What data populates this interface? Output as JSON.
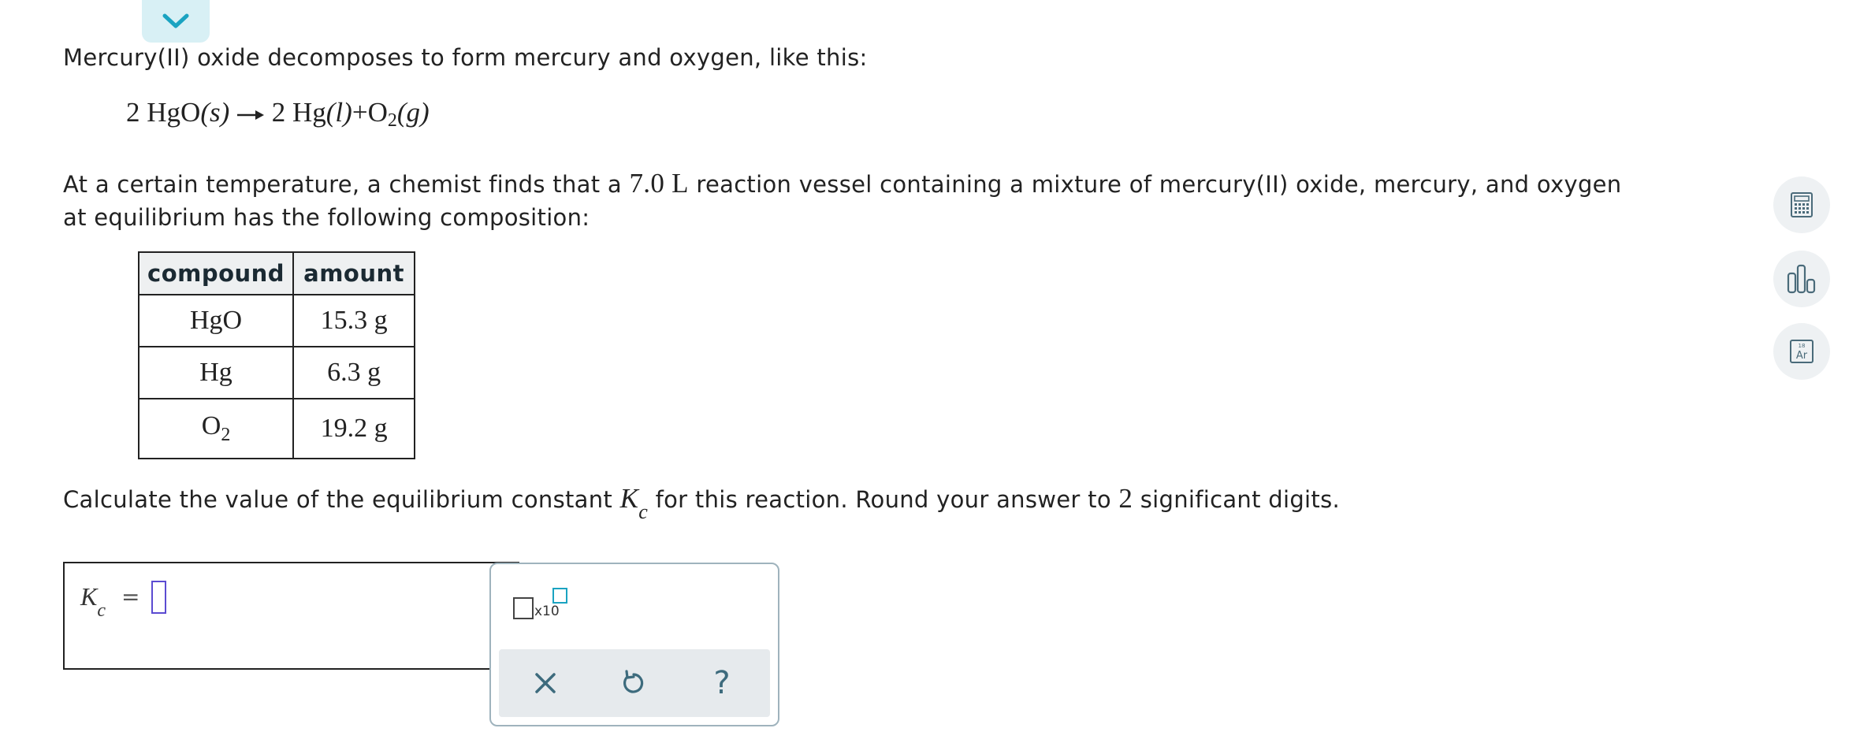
{
  "intro_text": "Mercury(II) oxide decomposes to form mercury and oxygen, like this:",
  "equation": {
    "coef1": "2",
    "reactant": "HgO",
    "reactant_phase": "(s)",
    "coef2": "2",
    "product1": "Hg",
    "product1_phase": "(l)",
    "product2": "O",
    "product2_sub": "2",
    "product2_phase": "(g)"
  },
  "context": {
    "before": "At a certain temperature, a chemist finds that a ",
    "volume": "7.0 L",
    "after": " reaction vessel containing a mixture of mercury(II) oxide, mercury, and oxygen at equilibrium has the following composition:"
  },
  "table": {
    "headers": [
      "compound",
      "amount"
    ],
    "rows": [
      {
        "compound": "HgO",
        "amount": "15.3 g"
      },
      {
        "compound": "Hg",
        "amount": "6.3 g"
      },
      {
        "compound": "O",
        "compound_sub": "2",
        "amount": "19.2 g"
      }
    ]
  },
  "question": {
    "before": "Calculate the value of the equilibrium constant ",
    "symbol": "K",
    "symbol_sub": "c",
    "middle": " for this reaction. Round your answer to ",
    "digits": "2",
    "after": " significant digits."
  },
  "answer": {
    "label": "K",
    "label_sub": "c",
    "equals": "=",
    "value": ""
  },
  "tools": {
    "x10_label": "x10",
    "clear_icon": "close-icon",
    "undo_icon": "undo-icon",
    "help_label": "?"
  },
  "side_tools": [
    "calculator-icon",
    "bar-chart-icon",
    "periodic-table-icon"
  ],
  "periodic_tile": {
    "number": "18",
    "symbol": "Ar"
  },
  "colors": {
    "accent": "#1aa3c1",
    "cursor": "#5b4bd1",
    "tab_bg": "#d8f0f5",
    "tool_border": "#9fb3bd"
  }
}
